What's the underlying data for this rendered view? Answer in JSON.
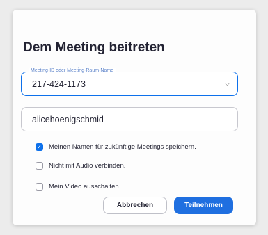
{
  "dialog": {
    "title": "Dem Meeting beitreten",
    "meeting_id_field": {
      "label": "Meeting-ID oder Meeting-Raum-Name",
      "value": "217-424-1173",
      "dropdown_icon": "chevron-down-icon"
    },
    "name_field": {
      "value": "alicehoenigschmid"
    },
    "options": [
      {
        "label": "Meinen Namen für zukünftige Meetings speichern.",
        "checked": true
      },
      {
        "label": "Nicht mit Audio verbinden.",
        "checked": false
      },
      {
        "label": "Mein Video ausschalten",
        "checked": false
      }
    ],
    "buttons": {
      "cancel_label": "Abbrechen",
      "join_label": "Teilnehmen"
    }
  },
  "colors": {
    "accent": "#0e71eb",
    "primary_button": "#1f6fe0",
    "text": "#232333"
  }
}
